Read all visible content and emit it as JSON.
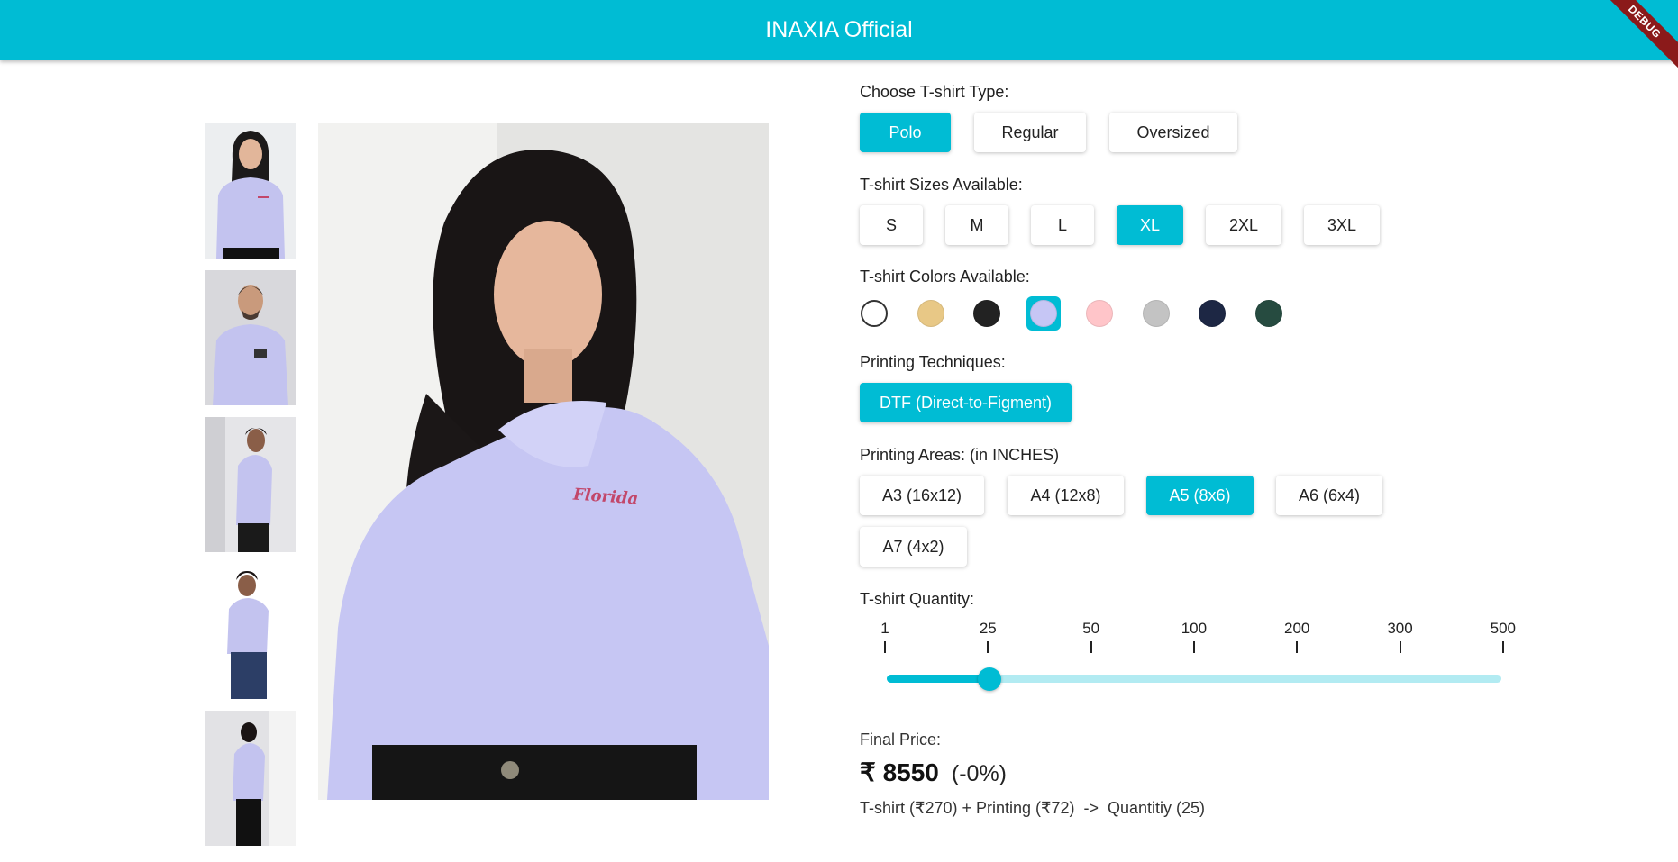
{
  "appbar": {
    "title": "INAXIA Official",
    "debug_label": "DEBUG"
  },
  "product": {
    "embroidery_text": "Florida",
    "thumbnails": [
      "woman-front",
      "man-smiling",
      "man-side",
      "man-walking",
      "man-back"
    ]
  },
  "type_section": {
    "label": "Choose T-shirt Type:",
    "options": [
      "Polo",
      "Regular",
      "Oversized"
    ],
    "selected": "Polo"
  },
  "size_section": {
    "label": "T-shirt Sizes Available:",
    "options": [
      "S",
      "M",
      "L",
      "XL",
      "2XL",
      "3XL"
    ],
    "selected": "XL"
  },
  "color_section": {
    "label": "T-shirt Colors Available:",
    "colors": [
      "#ffffff",
      "#e8c886",
      "#222222",
      "#c6c6f5",
      "#ffc5c9",
      "#c3c3c3",
      "#1d2744",
      "#264b40"
    ],
    "selected_index": 3
  },
  "technique_section": {
    "label": "Printing Techniques:",
    "options": [
      "DTF (Direct-to-Figment)"
    ],
    "selected": "DTF (Direct-to-Figment)"
  },
  "area_section": {
    "label": "Printing Areas: (in INCHES)",
    "options": [
      "A3 (16x12)",
      "A4 (12x8)",
      "A5 (8x6)",
      "A6 (6x4)",
      "A7 (4x2)"
    ],
    "selected": "A5 (8x6)"
  },
  "quantity_section": {
    "label": "T-shirt Quantity:",
    "ticks": [
      "1",
      "25",
      "50",
      "100",
      "200",
      "300",
      "500"
    ],
    "selected": "25",
    "fill_fraction": 0.167
  },
  "price": {
    "label": "Final Price:",
    "amount": "₹ 8550",
    "discount": "(-0%)",
    "breakdown": "T-shirt (₹270) + Printing (₹72)  ->  Quantitiy (25)"
  },
  "colors": {
    "accent": "#00bcd4",
    "accent_light": "#b2ebf2"
  }
}
